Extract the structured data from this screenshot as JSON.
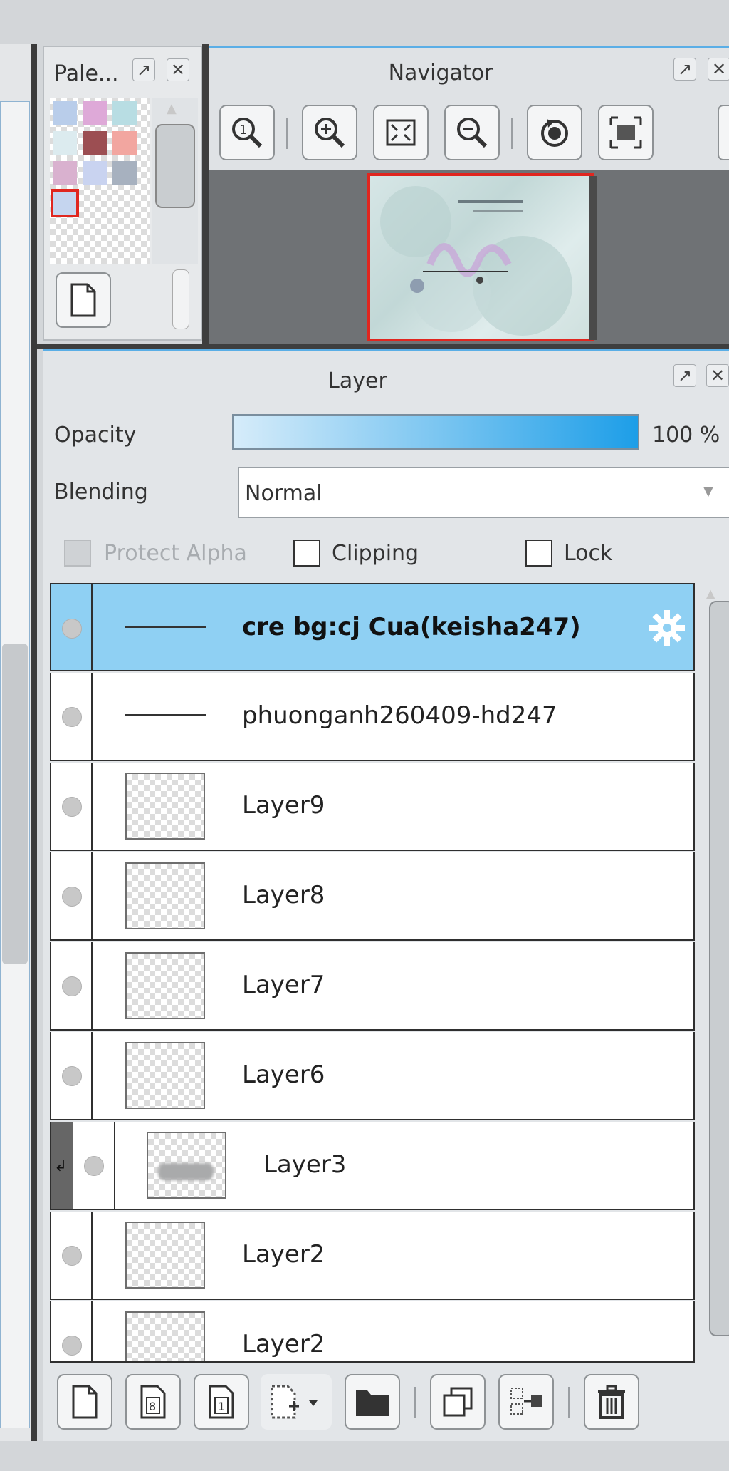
{
  "palette": {
    "title": "Pale...",
    "colors": [
      "#b9cdea",
      "#dea9d8",
      "#b8dde3",
      "#dcebef",
      "#9c4e52",
      "#f2a6a0",
      "#d9b1cf",
      "#c9d3f0",
      "#a7b1bf",
      "#c5d5ef"
    ],
    "selected_index": 9
  },
  "navigator": {
    "title": "Navigator",
    "tools": [
      "zoom-actual-icon",
      "zoom-in-icon",
      "fit-window-icon",
      "zoom-out-icon",
      "rotate-icon",
      "fullscreen-icon"
    ]
  },
  "layer_panel": {
    "title": "Layer",
    "opacity_label": "Opacity",
    "opacity_value": "100 %",
    "opacity_fraction": 1.0,
    "blending_label": "Blending",
    "blending_value": "Normal",
    "protect_alpha_label": "Protect Alpha",
    "clipping_label": "Clipping",
    "lock_label": "Lock",
    "layers": [
      {
        "name": "cre bg:cj Cua(keisha247)",
        "selected": true
      },
      {
        "name": "phuonganh260409-hd247"
      },
      {
        "name": "Layer9"
      },
      {
        "name": "Layer8"
      },
      {
        "name": "Layer7"
      },
      {
        "name": "Layer6"
      },
      {
        "name": "Layer3"
      },
      {
        "name": "Layer2"
      },
      {
        "name": "Layer2"
      }
    ]
  },
  "bottom_toolbar": {
    "buttons": [
      "new-layer-icon",
      "new-8bit-layer-icon",
      "new-1bit-layer-icon",
      "add-layer-menu-icon",
      "folder-icon",
      "duplicate-icon",
      "merge-down-icon",
      "delete-icon"
    ]
  }
}
